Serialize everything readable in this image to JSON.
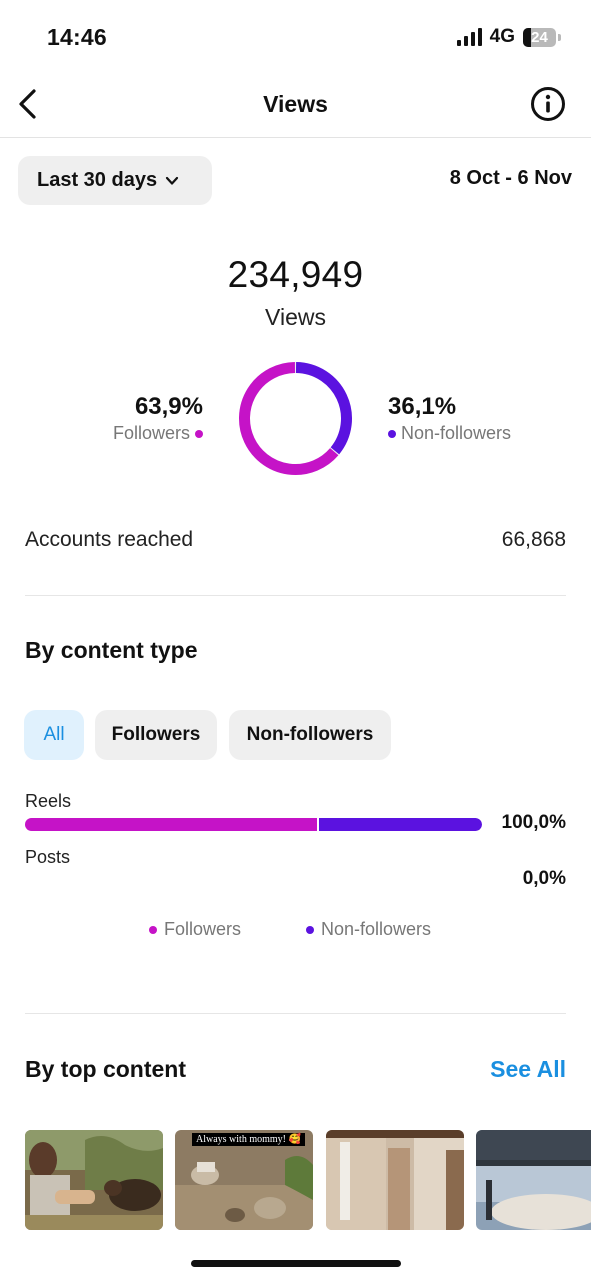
{
  "status": {
    "time": "14:46",
    "network": "4G",
    "battery": "24"
  },
  "nav": {
    "title": "Views"
  },
  "period": {
    "label": "Last 30 days",
    "range": "8 Oct - 6 Nov"
  },
  "summary": {
    "value": "234,949",
    "label": "Views"
  },
  "split": {
    "followers": {
      "pct": "63,9%",
      "label": "Followers",
      "value": 63.9,
      "color": "#c513c7"
    },
    "non_followers": {
      "pct": "36,1%",
      "label": "Non-followers",
      "value": 36.1,
      "color": "#5b12e0"
    }
  },
  "reached": {
    "label": "Accounts reached",
    "value": "66,868"
  },
  "content_type": {
    "title": "By content type",
    "filters": [
      {
        "label": "All",
        "active": true
      },
      {
        "label": "Followers",
        "active": false
      },
      {
        "label": "Non-followers",
        "active": false
      }
    ],
    "rows": [
      {
        "label": "Reels",
        "pct": "100,0%",
        "followers_share": 63.9,
        "non_followers_share": 36.1
      },
      {
        "label": "Posts",
        "pct": "0,0%",
        "followers_share": 0,
        "non_followers_share": 0
      }
    ],
    "legend": [
      {
        "label": "Followers",
        "color": "#c513c7"
      },
      {
        "label": "Non-followers",
        "color": "#5b12e0"
      }
    ]
  },
  "top_content": {
    "title": "By top content",
    "see_all": "See All",
    "items": [
      {
        "thumbnail": "man-with-dog-outdoors"
      },
      {
        "thumbnail": "rocky-ground",
        "caption": "Always with mommy! 🥰"
      },
      {
        "thumbnail": "apartment-hallway"
      },
      {
        "thumbnail": "patio-pergola"
      }
    ]
  },
  "icons": {
    "back": "chevron-left-icon",
    "info": "info-circle-icon",
    "dropdown": "chevron-down-icon"
  }
}
